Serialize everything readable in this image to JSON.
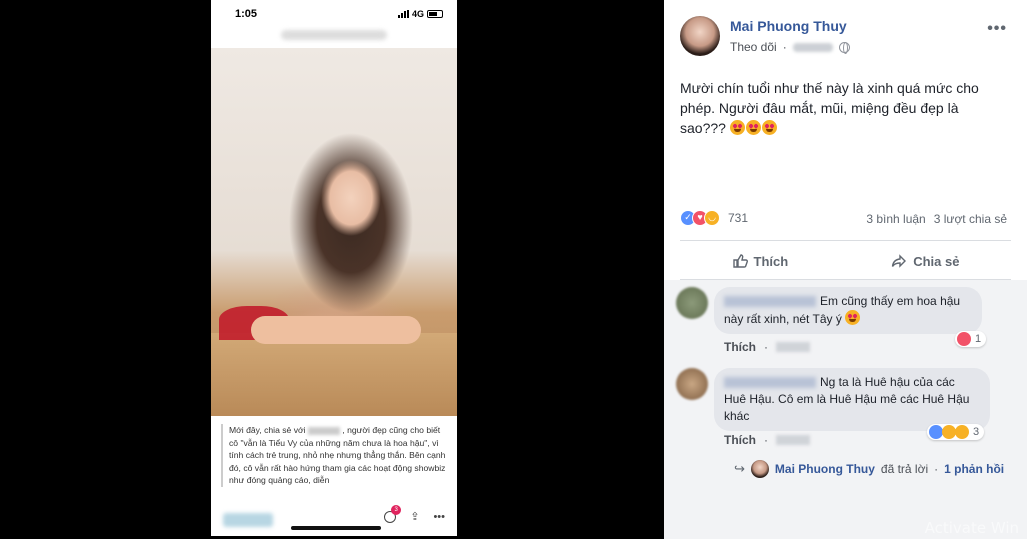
{
  "phone": {
    "time": "1:05",
    "network": "4G",
    "article_text_1": "Mới đây, chia sẻ với",
    "article_text_2": ", người đẹp cũng cho biết cô \"vẫn là Tiểu Vy của những năm chưa là hoa hậu\", vì tính cách trẻ trung, nhỏ nhẹ nhưng thẳng thắn. Bên cạnh đó, cô vẫn rất hào hứng tham gia các hoạt động showbiz như đóng quảng cáo, diễn",
    "notification_count": "3"
  },
  "post": {
    "author": "Mai Phuong Thuy",
    "follow_label": "Theo dõi",
    "text": "Mười chín tuổi như thế này là xinh quá mức cho phép. Người đâu mắt, mũi, miệng đều đẹp là sao???",
    "reaction_count": "731",
    "comments_count": "3 bình luận",
    "shares_count": "3 lượt chia sẻ",
    "like_label": "Thích",
    "share_label": "Chia sẻ"
  },
  "comments": [
    {
      "text": "Em cũng thấy em hoa hậu này rất xinh, nét Tây ý",
      "like_label": "Thích",
      "reaction_count": "1"
    },
    {
      "text": "Ng ta là Huê hậu của các Huê Hậu. Cô em là Huê Hậu mê các Huê Hậu khác",
      "like_label": "Thích",
      "reaction_count": "3"
    }
  ],
  "reply_summary": {
    "name": "Mai Phuong Thuy",
    "text": "đã trả lời",
    "count": "1 phản hồi"
  },
  "watermark": "Activate Win"
}
